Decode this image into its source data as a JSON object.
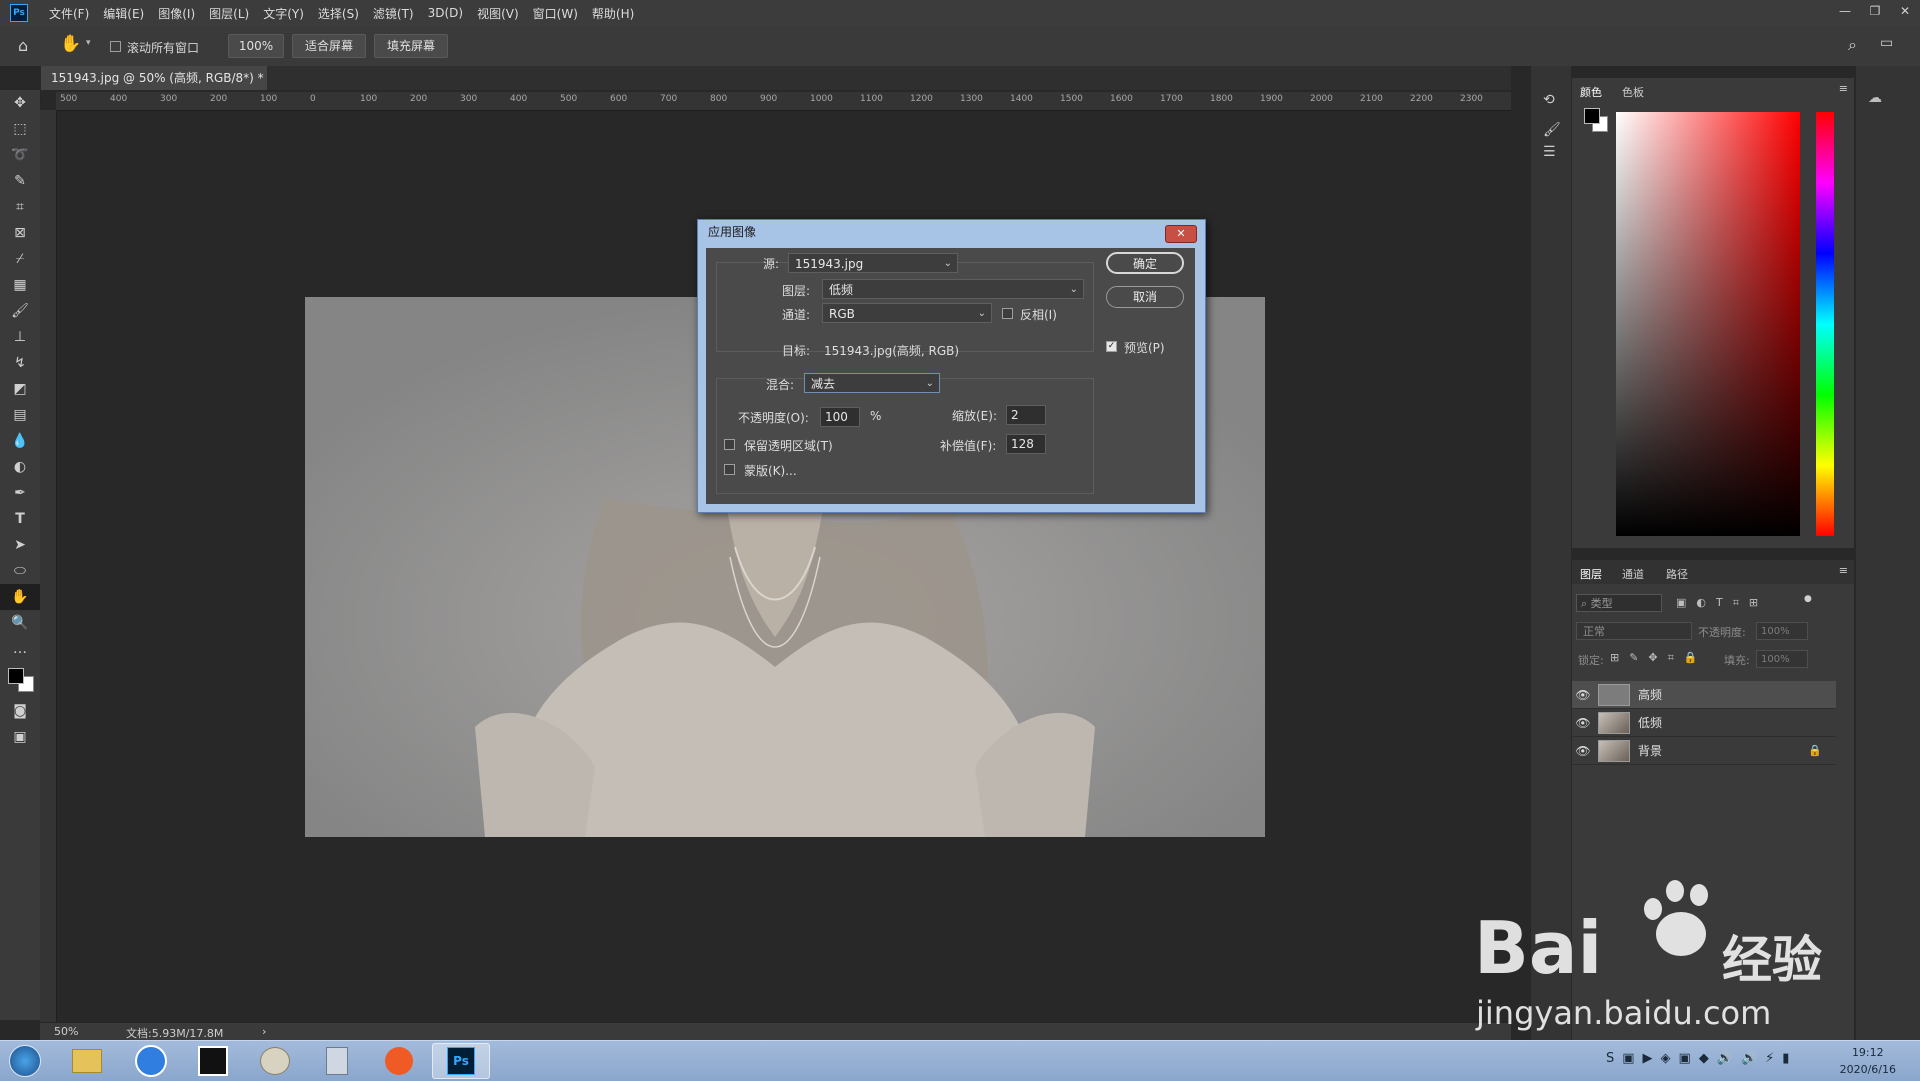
{
  "menubar": {
    "logo": "Ps",
    "items": [
      "文件(F)",
      "编辑(E)",
      "图像(I)",
      "图层(L)",
      "文字(Y)",
      "选择(S)",
      "滤镜(T)",
      "3D(D)",
      "视图(V)",
      "窗口(W)",
      "帮助(H)"
    ]
  },
  "options": {
    "scroll_all_label": "滚动所有窗口",
    "zoom_btn": "100%",
    "fit_screen_btn": "适合屏幕",
    "fill_screen_btn": "填充屏幕"
  },
  "document": {
    "tab_title": "151943.jpg @ 50% (高频, RGB/8*) *",
    "zoom": "50%",
    "doc_info": "文档:5.93M/17.8M"
  },
  "ruler_ticks": [
    "500",
    "400",
    "300",
    "200",
    "100",
    "0",
    "100",
    "200",
    "300",
    "400",
    "500",
    "600",
    "700",
    "800",
    "900",
    "1000",
    "1100",
    "1200",
    "1300",
    "1400",
    "1500",
    "1600",
    "1700",
    "1800",
    "1900",
    "2000",
    "2100",
    "2200",
    "2300"
  ],
  "dialog": {
    "title": "应用图像",
    "source_label": "源:",
    "source_value": "151943.jpg",
    "layer_label": "图层:",
    "layer_value": "低频",
    "channel_label": "通道:",
    "channel_value": "RGB",
    "invert_label": "反相(I)",
    "target_label": "目标:",
    "target_value": "151943.jpg(高频, RGB)",
    "blend_label": "混合:",
    "blend_value": "减去",
    "opacity_label": "不透明度(O):",
    "opacity_value": "100",
    "percent": "%",
    "scale_label": "缩放(E):",
    "scale_value": "2",
    "offset_label": "补偿值(F):",
    "offset_value": "128",
    "preserve_label": "保留透明区域(T)",
    "mask_label": "蒙版(K)...",
    "ok_button": "确定",
    "cancel_button": "取消",
    "preview_label": "预览(P)",
    "preview_checked": true,
    "invert_checked": false
  },
  "color_panel": {
    "tabs": [
      "颜色",
      "色板"
    ]
  },
  "layers_panel": {
    "tabs": [
      "图层",
      "通道",
      "路径"
    ],
    "filter_placeholder": "类型",
    "blend_mode": "正常",
    "opacity_label": "不透明度:",
    "opacity_value": "100%",
    "lock_label": "锁定:",
    "fill_label": "填充:",
    "fill_value": "100%",
    "layers": [
      {
        "name": "高频",
        "selected": true,
        "locked": false
      },
      {
        "name": "低频",
        "selected": false,
        "locked": false
      },
      {
        "name": "背景",
        "selected": false,
        "locked": true
      }
    ]
  },
  "taskbar": {
    "time": "19:12",
    "date": "2020/6/16",
    "ps_label": "Ps"
  },
  "watermark": {
    "brand": "Bai",
    "brand_cn": "经验",
    "url": "jingyan.baidu.com"
  },
  "colors": {
    "accent_blue": "#31a8ff",
    "dialog_titlebar": "#a7c3e5",
    "close_red": "#c74f43"
  }
}
